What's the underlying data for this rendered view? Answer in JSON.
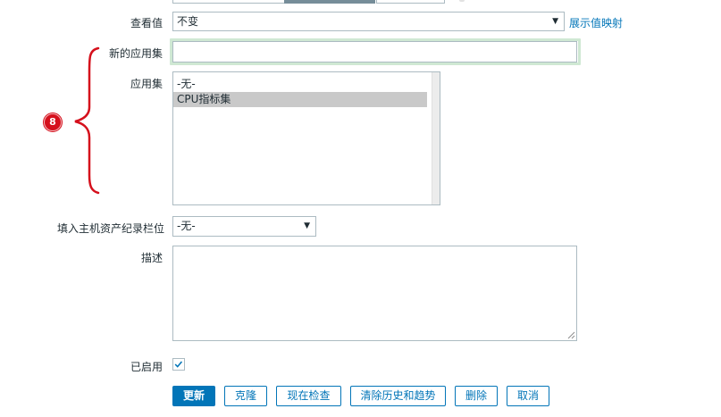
{
  "form": {
    "show_value": {
      "label": "查看值",
      "selected": "不变",
      "link": "展示值映射"
    },
    "new_application": {
      "label": "新的应用集",
      "value": ""
    },
    "applications": {
      "label": "应用集",
      "options": [
        "-无-",
        "CPU指标集"
      ],
      "selected_index": 1
    },
    "inventory_field": {
      "label": "填入主机资产纪录栏位",
      "selected": "-无-"
    },
    "description": {
      "label": "描述",
      "value": ""
    },
    "enabled": {
      "label": "已启用",
      "checked": true
    }
  },
  "buttons": {
    "update": "更新",
    "clone": "克隆",
    "check_now": "现在检查",
    "clear_history": "清除历史和趋势",
    "delete": "删除",
    "cancel": "取消"
  },
  "annotation": {
    "badge_number": "8",
    "brace_color": "#d5101c"
  },
  "colors": {
    "accent": "#0275b8",
    "border": "#acbbc2",
    "focus_glow": "#cfe8d3",
    "selected_option": "#c9c9c9"
  }
}
